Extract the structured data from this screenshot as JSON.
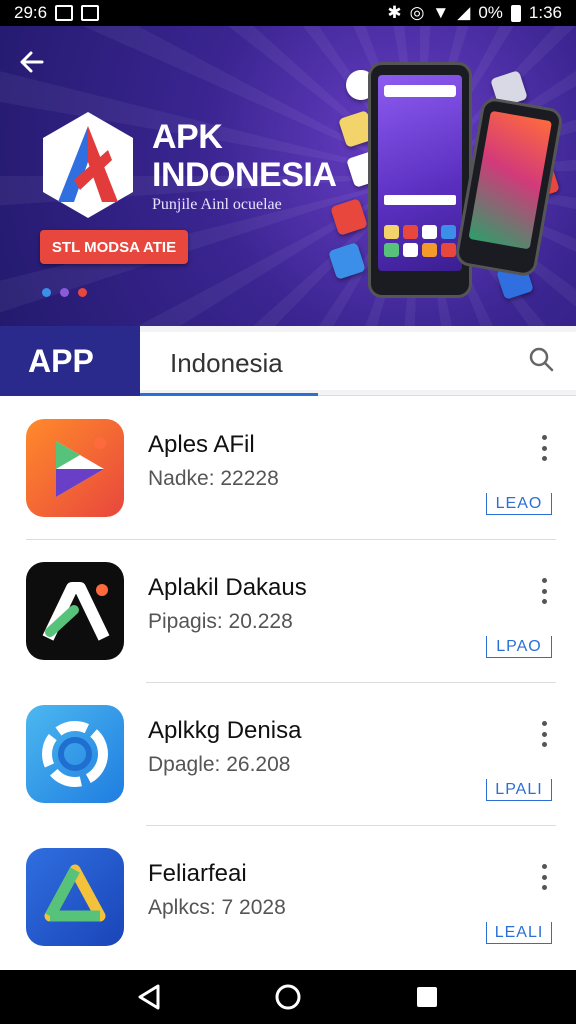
{
  "status_bar": {
    "time_left": "29:6",
    "battery": "0%",
    "time_right": "1:36"
  },
  "banner": {
    "back_icon": "back-arrow-icon",
    "title_line1": "APK",
    "title_line2": "INDONESIA",
    "subtitle": "Punjile Ainl ocuelae",
    "cta_label": "STL MODSA ATIE"
  },
  "search": {
    "app_label": "APP",
    "query": "Indonesia",
    "icon": "search-icon"
  },
  "apps": [
    {
      "name": "Aples AFil",
      "meta": "Nadke: 22228",
      "action": "LEAO",
      "icon": "drive-orange-icon"
    },
    {
      "name": "Aplakil Dakaus",
      "meta": "Pipagis: 20.228",
      "action": "LPAO",
      "icon": "a-letter-black-icon"
    },
    {
      "name": "Aplkkg Denisa",
      "meta": "Dpagle: 26.208",
      "action": "LPALI",
      "icon": "gear-blue-icon"
    },
    {
      "name": "Feliarfeai",
      "meta": "Aplkcs: 7 2028",
      "action": "LEALI",
      "icon": "drive-blue-icon"
    }
  ],
  "nav": {
    "back": "nav-back-icon",
    "home": "nav-home-icon",
    "recents": "nav-recents-icon"
  },
  "colors": {
    "accent": "#2b6fd6",
    "cta": "#e8473d",
    "banner": "#3b2591",
    "app_label_bg": "#2a2a8c"
  }
}
